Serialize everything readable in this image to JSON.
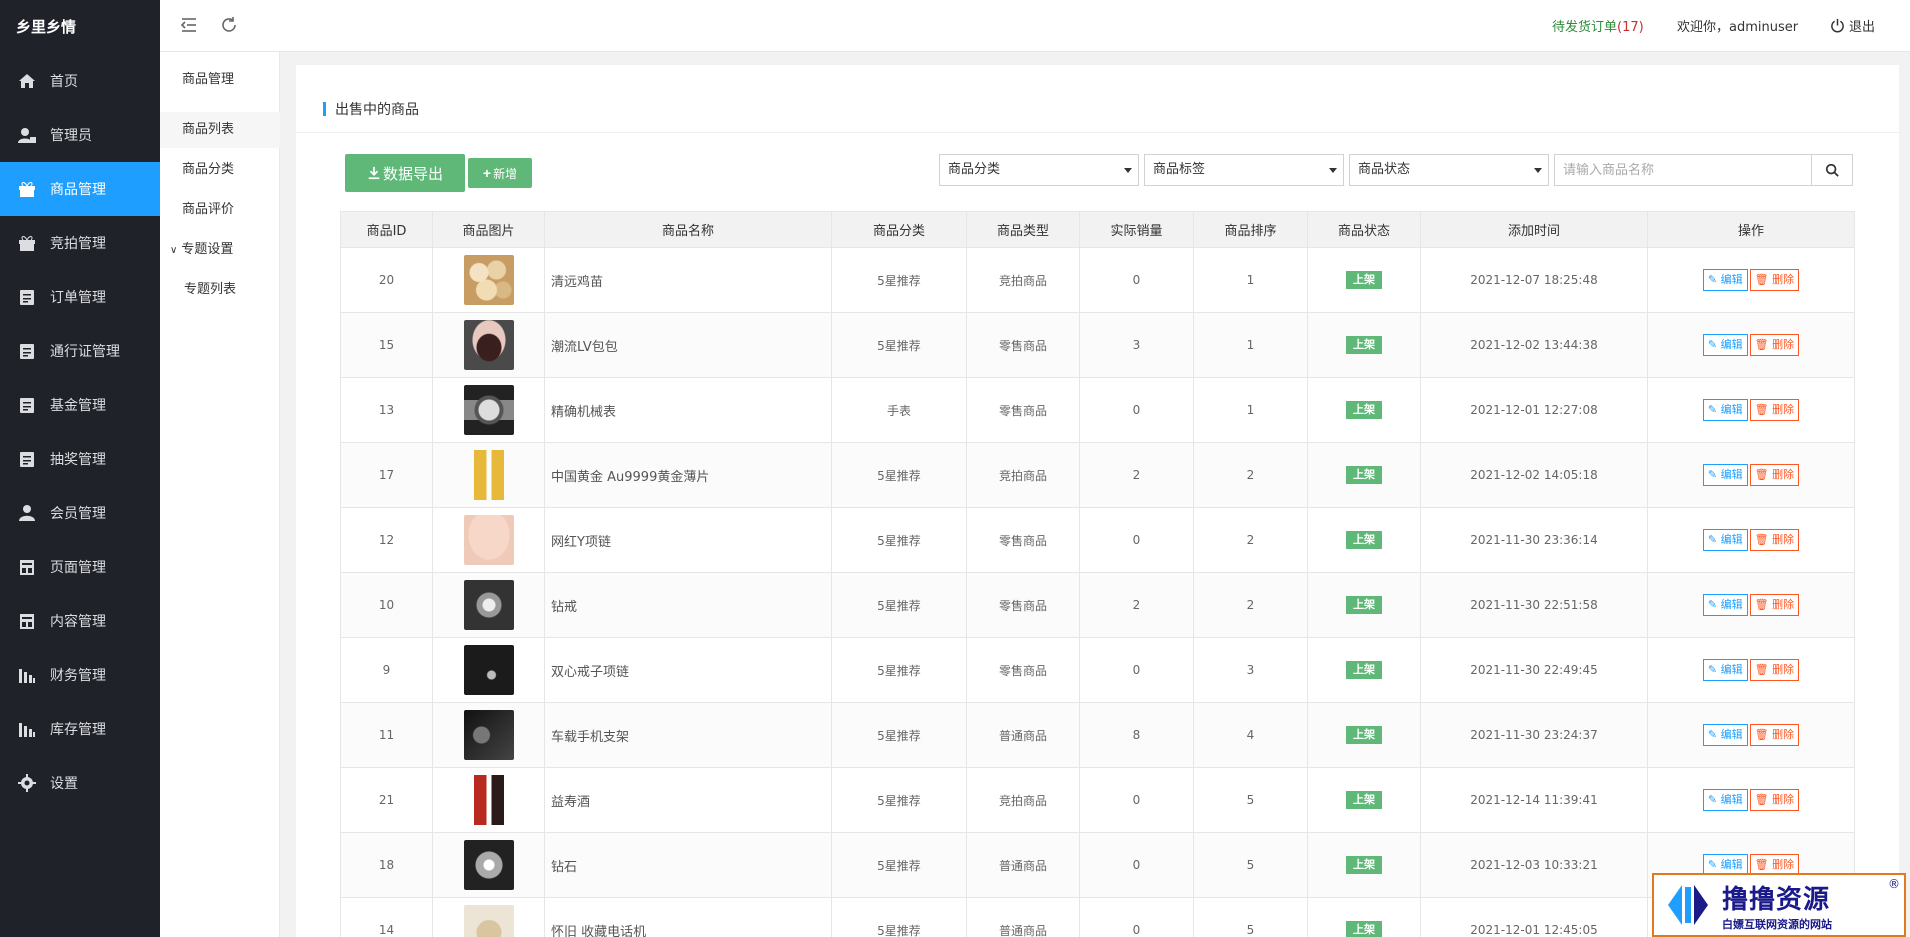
{
  "app": {
    "brand": "乡里乡情"
  },
  "sidebar": {
    "items": [
      {
        "label": "首页",
        "icon": "home-icon",
        "active": false
      },
      {
        "label": "管理员",
        "icon": "admin-icon",
        "active": false
      },
      {
        "label": "商品管理",
        "icon": "gift-icon",
        "active": true
      },
      {
        "label": "竞拍管理",
        "icon": "gift-icon",
        "active": false
      },
      {
        "label": "订单管理",
        "icon": "clipboard-icon",
        "active": false
      },
      {
        "label": "通行证管理",
        "icon": "clipboard-icon",
        "active": false
      },
      {
        "label": "基金管理",
        "icon": "clipboard-icon",
        "active": false
      },
      {
        "label": "抽奖管理",
        "icon": "clipboard-icon",
        "active": false
      },
      {
        "label": "会员管理",
        "icon": "user-icon",
        "active": false
      },
      {
        "label": "页面管理",
        "icon": "page-icon",
        "active": false
      },
      {
        "label": "内容管理",
        "icon": "page-icon",
        "active": false
      },
      {
        "label": "财务管理",
        "icon": "finance-icon",
        "active": false
      },
      {
        "label": "库存管理",
        "icon": "finance-icon",
        "active": false
      },
      {
        "label": "设置",
        "icon": "gear-icon",
        "active": false
      }
    ]
  },
  "submenu": {
    "title": "商品管理",
    "items": [
      "商品列表",
      "商品分类",
      "商品评价"
    ],
    "group": "专题设置",
    "group_items": [
      "专题列表"
    ]
  },
  "topbar": {
    "pending_label": "待发货订单",
    "pending_count": "(17)",
    "welcome": "欢迎你，adminuser",
    "logout": "退出"
  },
  "page": {
    "title": "出售中的商品",
    "export_label": "数据导出",
    "add_label": "新增",
    "filters": {
      "category": "商品分类",
      "tag": "商品标签",
      "status": "商品状态"
    },
    "search": {
      "placeholder": "请输入商品名称",
      "value": ""
    }
  },
  "table": {
    "columns": [
      "商品ID",
      "商品图片",
      "商品名称",
      "商品分类",
      "商品类型",
      "实际销量",
      "商品排序",
      "商品状态",
      "添加时间",
      "操作"
    ],
    "edit_label": "编辑",
    "delete_label": "删除",
    "rows": [
      {
        "id": "20",
        "image": "chicken-eggs",
        "name": "清远鸡苗",
        "category": "5星推荐",
        "type": "竞拍商品",
        "sales": "0",
        "sort": "1",
        "status": "上架",
        "time": "2021-12-07 18:25:48"
      },
      {
        "id": "15",
        "image": "handbag",
        "name": "潮流LV包包",
        "category": "5星推荐",
        "type": "零售商品",
        "sales": "3",
        "sort": "1",
        "status": "上架",
        "time": "2021-12-02 13:44:38"
      },
      {
        "id": "13",
        "image": "watch",
        "name": "精确机械表",
        "category": "手表",
        "type": "零售商品",
        "sales": "0",
        "sort": "1",
        "status": "上架",
        "time": "2021-12-01 12:27:08"
      },
      {
        "id": "17",
        "image": "gold-bars",
        "name": "中国黄金 Au9999黄金薄片",
        "category": "5星推荐",
        "type": "竞拍商品",
        "sales": "2",
        "sort": "2",
        "status": "上架",
        "time": "2021-12-02 14:05:18"
      },
      {
        "id": "12",
        "image": "necklace",
        "name": "网红Y项链",
        "category": "5星推荐",
        "type": "零售商品",
        "sales": "0",
        "sort": "2",
        "status": "上架",
        "time": "2021-11-30 23:36:14"
      },
      {
        "id": "10",
        "image": "ring",
        "name": "钻戒",
        "category": "5星推荐",
        "type": "零售商品",
        "sales": "2",
        "sort": "2",
        "status": "上架",
        "time": "2021-11-30 22:51:58"
      },
      {
        "id": "9",
        "image": "pendant",
        "name": "双心戒子项链",
        "category": "5星推荐",
        "type": "零售商品",
        "sales": "0",
        "sort": "3",
        "status": "上架",
        "time": "2021-11-30 22:49:45"
      },
      {
        "id": "11",
        "image": "phone-holder",
        "name": "车载手机支架",
        "category": "5星推荐",
        "type": "普通商品",
        "sales": "8",
        "sort": "4",
        "status": "上架",
        "time": "2021-11-30 23:24:37"
      },
      {
        "id": "21",
        "image": "liquor",
        "name": "益寿酒",
        "category": "5星推荐",
        "type": "竞拍商品",
        "sales": "0",
        "sort": "5",
        "status": "上架",
        "time": "2021-12-14 11:39:41"
      },
      {
        "id": "18",
        "image": "diamond",
        "name": "钻石",
        "category": "5星推荐",
        "type": "普通商品",
        "sales": "0",
        "sort": "5",
        "status": "上架",
        "time": "2021-12-03 10:33:21"
      },
      {
        "id": "14",
        "image": "phone",
        "name": "怀旧 收藏电话机",
        "category": "5星推荐",
        "type": "普通商品",
        "sales": "0",
        "sort": "5",
        "status": "上架",
        "time": "2021-12-01 12:45:05"
      }
    ]
  },
  "watermark": {
    "title": "撸撸资源",
    "subtitle": "白嫖互联网资源的网站",
    "reg": "®"
  },
  "colors": {
    "sidebar_bg": "#20222a",
    "active": "#1e9fff",
    "green": "#5fb878",
    "danger": "#ff5722"
  }
}
